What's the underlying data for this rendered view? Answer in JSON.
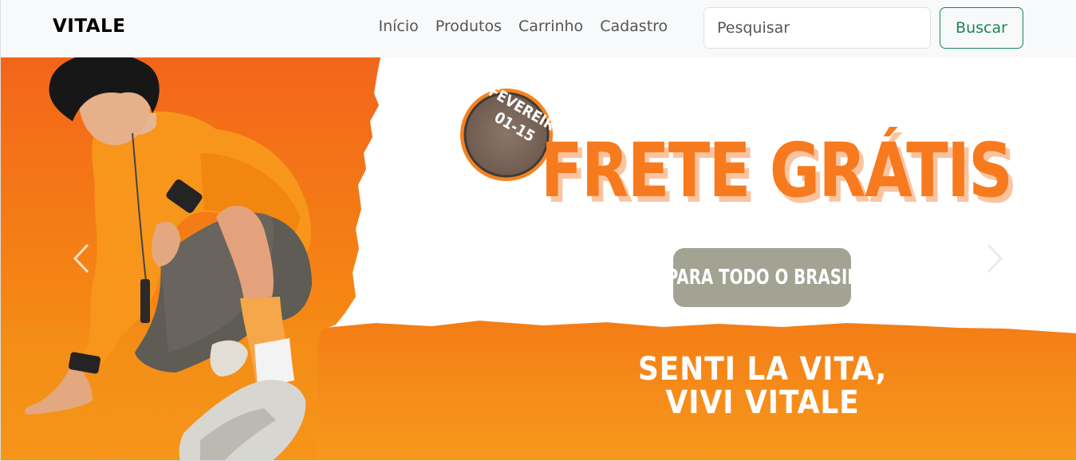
{
  "navbar": {
    "brand": "VITALE",
    "links": [
      "Início",
      "Produtos",
      "Carrinho",
      "Cadastro"
    ],
    "search": {
      "placeholder": "Pesquisar",
      "value": ""
    },
    "search_button": "Buscar"
  },
  "banner": {
    "date_badge_line1": "FEVEREIRO",
    "date_badge_line2": "01-15",
    "headline": "FRETE GRÁTIS",
    "subheadline": "PARA TODO O BRASIL",
    "tagline_line1": "SENTI LA VITA,",
    "tagline_line2": "VIVI VITALE"
  },
  "carousel": {
    "prev_icon": "chevron-left-icon",
    "next_icon": "chevron-right-icon"
  },
  "colors": {
    "accent_orange": "#f77a1f",
    "banner_orange": "#f58b1c",
    "button_green": "#198754",
    "pill_gray": "#a3a394"
  }
}
